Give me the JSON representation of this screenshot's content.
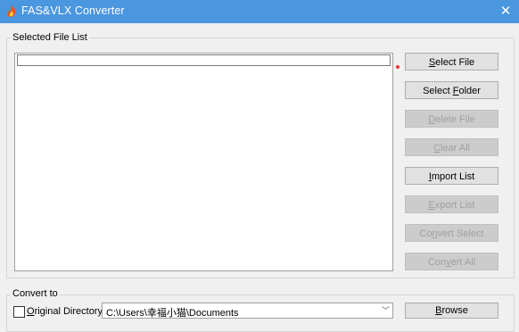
{
  "window": {
    "title": "FAS&VLX Converter",
    "app_icon": "app-flame-icon",
    "close_glyph": "✕"
  },
  "selected_file_list": {
    "legend": "Selected File List",
    "items": []
  },
  "buttons": {
    "select_file": {
      "pre": "",
      "acc": "S",
      "post": "elect File",
      "enabled": true
    },
    "select_folder": {
      "pre": "Select ",
      "acc": "F",
      "post": "older",
      "enabled": true
    },
    "delete_file": {
      "pre": "",
      "acc": "D",
      "post": "elete File",
      "enabled": false
    },
    "clear_all": {
      "pre": "",
      "acc": "C",
      "post": "lear All",
      "enabled": false
    },
    "import_list": {
      "pre": "",
      "acc": "I",
      "post": "mport List",
      "enabled": true
    },
    "export_list": {
      "pre": "",
      "acc": "E",
      "post": "xport List",
      "enabled": false
    },
    "convert_select": {
      "pre": "Co",
      "acc": "n",
      "post": "vert Select",
      "enabled": false
    },
    "convert_all": {
      "pre": "Con",
      "acc": "v",
      "post": "ert All",
      "enabled": false
    }
  },
  "convert_to": {
    "legend": "Convert to",
    "original_directory": {
      "pre": "",
      "acc": "O",
      "post": "riginal Directory",
      "checked": false
    },
    "path": "C:\\Users\\幸福小猫\\Documents",
    "chevron": "﹀",
    "browse": {
      "pre": "",
      "acc": "B",
      "post": "rowse"
    }
  }
}
